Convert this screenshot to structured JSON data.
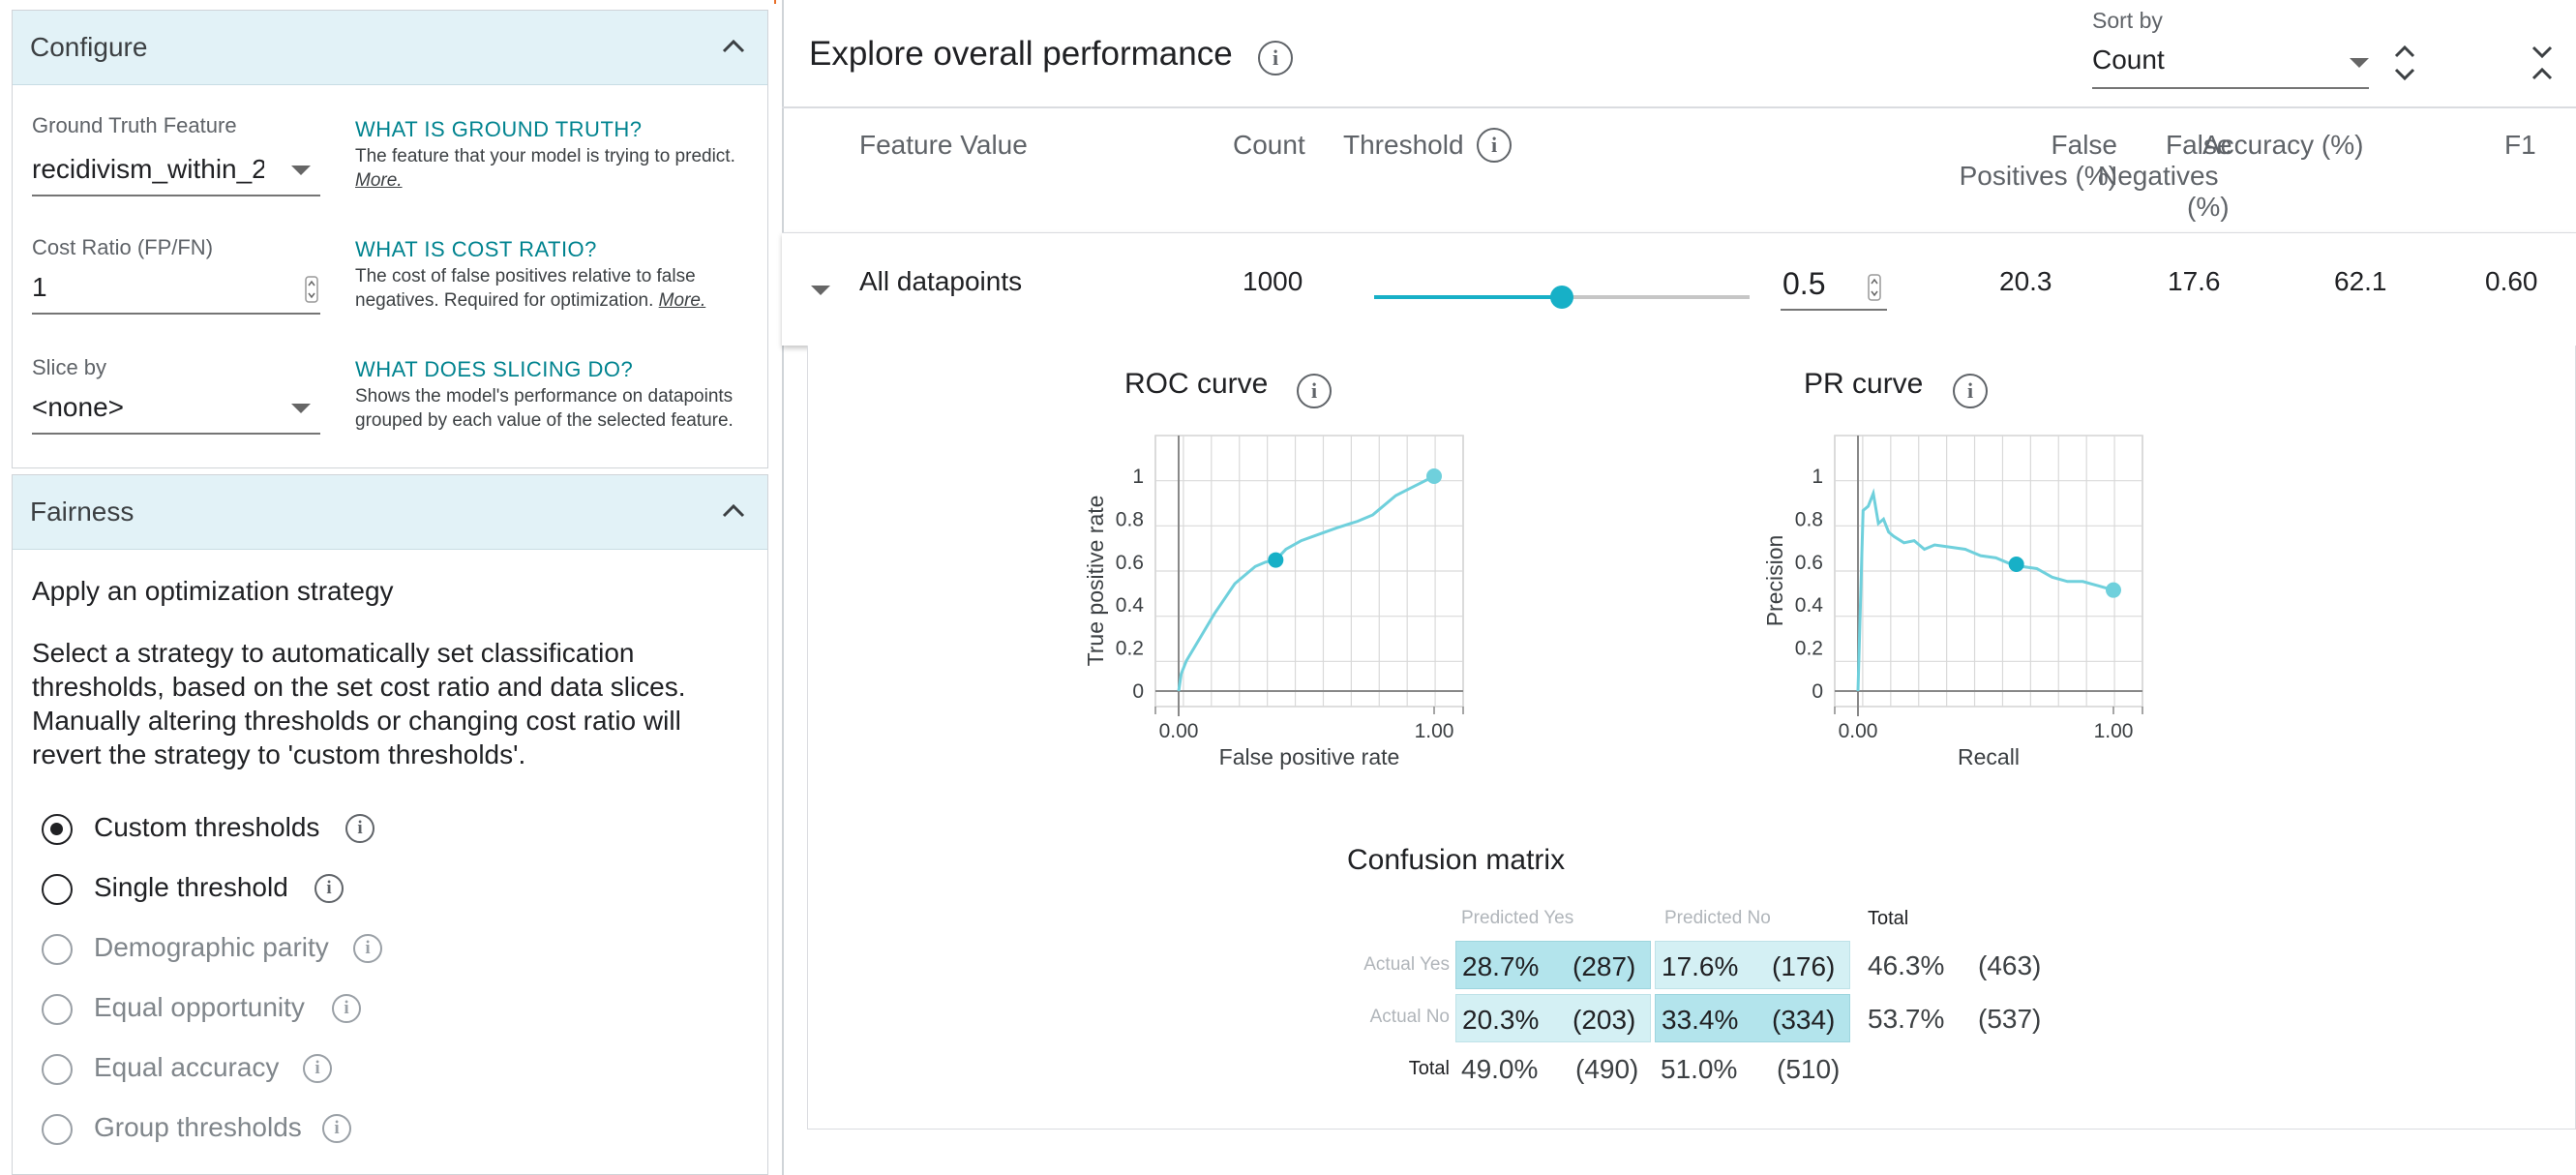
{
  "configure": {
    "title": "Configure",
    "ground_truth": {
      "label": "Ground Truth Feature",
      "value": "recidivism_within_2_",
      "help_title": "WHAT IS GROUND TRUTH?",
      "help_text": "The feature that your model is trying to predict.",
      "help_link": "More."
    },
    "cost_ratio": {
      "label": "Cost Ratio (FP/FN)",
      "value": "1",
      "help_title": "WHAT IS COST RATIO?",
      "help_text": "The cost of false positives relative to false negatives. Required for optimization.",
      "help_link": "More."
    },
    "slice_by": {
      "label": "Slice by",
      "value": "<none>",
      "help_title": "WHAT DOES SLICING DO?",
      "help_text": "Shows the model's performance on datapoints grouped by each value of the selected feature."
    }
  },
  "fairness": {
    "title": "Fairness",
    "subtitle": "Apply an optimization strategy",
    "description": "Select a strategy to automatically set classification thresholds, based on the set cost ratio and data slices. Manually altering thresholds or changing cost ratio will revert the strategy to 'custom thresholds'.",
    "options": [
      {
        "label": "Custom thresholds",
        "selected": true,
        "enabled": true
      },
      {
        "label": "Single threshold",
        "selected": false,
        "enabled": true
      },
      {
        "label": "Demographic parity",
        "selected": false,
        "enabled": false
      },
      {
        "label": "Equal opportunity",
        "selected": false,
        "enabled": false
      },
      {
        "label": "Equal accuracy",
        "selected": false,
        "enabled": false
      },
      {
        "label": "Group thresholds",
        "selected": false,
        "enabled": false
      }
    ]
  },
  "performance": {
    "title": "Explore overall performance",
    "sort_by_label": "Sort by",
    "sort_by_value": "Count",
    "columns": {
      "feature_value": "Feature Value",
      "count": "Count",
      "threshold": "Threshold",
      "false_positives": [
        "False",
        "Positives (%)"
      ],
      "false_negatives": [
        "False",
        "Negatives",
        "(%)"
      ],
      "accuracy": "Accuracy (%)",
      "f1": "F1"
    },
    "row": {
      "name": "All datapoints",
      "count": "1000",
      "threshold": "0.5",
      "threshold_fraction": 0.5,
      "false_positives": "20.3",
      "false_negatives": "17.6",
      "accuracy": "62.1",
      "f1": "0.60"
    }
  },
  "chart_data": [
    {
      "type": "line",
      "title": "ROC curve",
      "xlabel": "False positive rate",
      "ylabel": "True positive rate",
      "xlim": [
        0,
        1
      ],
      "ylim": [
        0,
        1
      ],
      "x_tick_labels": [
        "0.00",
        "1.00"
      ],
      "y_tick_labels": [
        "0",
        "0.2",
        "0.4",
        "0.6",
        "0.8",
        "1"
      ],
      "grid": true,
      "series": [
        {
          "x": [
            0,
            0.01,
            0.03,
            0.06,
            0.1,
            0.14,
            0.18,
            0.22,
            0.26,
            0.3,
            0.34,
            0.38,
            0.42,
            0.48,
            0.55,
            0.62,
            0.7,
            0.76,
            0.8,
            0.85,
            0.9,
            0.95,
            1.0
          ],
          "y": [
            0,
            0.08,
            0.14,
            0.2,
            0.28,
            0.36,
            0.43,
            0.5,
            0.54,
            0.58,
            0.6,
            0.61,
            0.66,
            0.7,
            0.73,
            0.76,
            0.79,
            0.82,
            0.86,
            0.91,
            0.94,
            0.97,
            1.0
          ]
        }
      ],
      "highlight_point": {
        "x": 0.38,
        "y": 0.61
      },
      "end_point": {
        "x": 1.0,
        "y": 1.0
      }
    },
    {
      "type": "line",
      "title": "PR curve",
      "xlabel": "Recall",
      "ylabel": "Precision",
      "xlim": [
        0,
        1
      ],
      "ylim": [
        0,
        1
      ],
      "x_tick_labels": [
        "0.00",
        "1.00"
      ],
      "y_tick_labels": [
        "0",
        "0.2",
        "0.4",
        "0.6",
        "0.8",
        "1"
      ],
      "grid": true,
      "series": [
        {
          "x": [
            0,
            0.02,
            0.04,
            0.06,
            0.08,
            0.1,
            0.12,
            0.14,
            0.18,
            0.22,
            0.26,
            0.3,
            0.36,
            0.42,
            0.48,
            0.54,
            0.6,
            0.64,
            0.7,
            0.76,
            0.82,
            0.88,
            0.94,
            1.0
          ],
          "y": [
            0,
            0.84,
            0.86,
            0.92,
            0.78,
            0.8,
            0.74,
            0.72,
            0.69,
            0.7,
            0.66,
            0.68,
            0.67,
            0.66,
            0.63,
            0.62,
            0.59,
            0.58,
            0.57,
            0.53,
            0.51,
            0.51,
            0.49,
            0.47
          ]
        }
      ],
      "highlight_point": {
        "x": 0.62,
        "y": 0.59
      },
      "end_point": {
        "x": 1.0,
        "y": 0.47
      }
    }
  ],
  "confusion_matrix": {
    "title": "Confusion matrix",
    "col_headers": [
      "Predicted Yes",
      "Predicted No",
      "Total"
    ],
    "row_headers": [
      "Actual Yes",
      "Actual No",
      "Total"
    ],
    "cells": [
      [
        {
          "pct": "28.7%",
          "count": "(287)"
        },
        {
          "pct": "17.6%",
          "count": "(176)"
        },
        {
          "pct": "46.3%",
          "count": "(463)"
        }
      ],
      [
        {
          "pct": "20.3%",
          "count": "(203)"
        },
        {
          "pct": "33.4%",
          "count": "(334)"
        },
        {
          "pct": "53.7%",
          "count": "(537)"
        }
      ],
      [
        {
          "pct": "49.0%",
          "count": "(490)"
        },
        {
          "pct": "51.0%",
          "count": "(510)"
        }
      ]
    ],
    "colors": {
      "strong": "#b3e4ec",
      "light": "#d4f0f4"
    }
  },
  "colors": {
    "accent": "#17b0c7",
    "header_bg": "#e2f2f7",
    "link": "#00838f",
    "tab_accent": "#e8702a"
  }
}
